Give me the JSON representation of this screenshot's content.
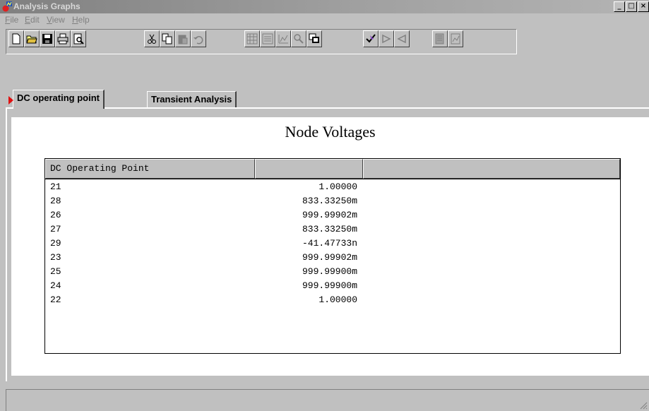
{
  "window": {
    "title": "Analysis Graphs",
    "controls": {
      "minimize": "_",
      "maximize": "□",
      "close": "×"
    }
  },
  "menu": {
    "items": [
      {
        "label": "File",
        "accel": "F",
        "rest": "ile"
      },
      {
        "label": "Edit",
        "accel": "E",
        "rest": "dit"
      },
      {
        "label": "View",
        "accel": "V",
        "rest": "iew"
      },
      {
        "label": "Help",
        "accel": "H",
        "rest": "elp"
      }
    ]
  },
  "toolbar": {
    "buttons": [
      {
        "icon": "new-file-icon",
        "enabled": true
      },
      {
        "icon": "open-folder-icon",
        "enabled": true
      },
      {
        "icon": "save-icon",
        "enabled": true
      },
      {
        "icon": "print-icon",
        "enabled": true
      },
      {
        "icon": "print-preview-icon",
        "enabled": true
      },
      {
        "icon": "cut-icon",
        "enabled": true
      },
      {
        "icon": "copy-icon",
        "enabled": true
      },
      {
        "icon": "paste-icon",
        "enabled": false
      },
      {
        "icon": "undo-icon",
        "enabled": false
      },
      {
        "icon": "grid-icon",
        "enabled": false
      },
      {
        "icon": "list-icon",
        "enabled": false
      },
      {
        "icon": "chart-icon",
        "enabled": false
      },
      {
        "icon": "zoom-icon",
        "enabled": false
      },
      {
        "icon": "overlay-icon",
        "enabled": true
      },
      {
        "icon": "cursor-check-icon",
        "enabled": true
      },
      {
        "icon": "cursor-next-icon",
        "enabled": false
      },
      {
        "icon": "cursor-prev-icon",
        "enabled": false
      },
      {
        "icon": "export-icon",
        "enabled": false
      },
      {
        "icon": "export-chart-icon",
        "enabled": false
      }
    ]
  },
  "tabs": [
    {
      "label": "DC operating point",
      "active": true
    },
    {
      "label": "Transient Analysis",
      "active": false
    }
  ],
  "graph": {
    "title": "Node Voltages",
    "table": {
      "headers": [
        "DC Operating Point",
        "",
        ""
      ],
      "rows": [
        {
          "node": "21",
          "value": "1.00000"
        },
        {
          "node": "28",
          "value": "833.33250m"
        },
        {
          "node": "26",
          "value": "999.99902m"
        },
        {
          "node": "27",
          "value": "833.33250m"
        },
        {
          "node": "29",
          "value": "-41.47733n"
        },
        {
          "node": "23",
          "value": "999.99902m"
        },
        {
          "node": "25",
          "value": "999.99900m"
        },
        {
          "node": "24",
          "value": "999.99900m"
        },
        {
          "node": "22",
          "value": "1.00000"
        }
      ]
    }
  },
  "colors": {
    "face": "#c0c0c0",
    "titlebar_inactive": "#808080",
    "tab_marker": "#e01010"
  }
}
